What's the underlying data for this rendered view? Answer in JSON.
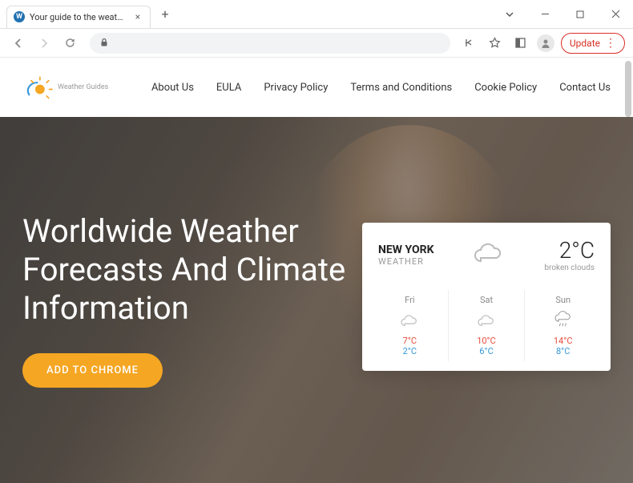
{
  "browser": {
    "tab_title": "Your guide to the weather – wor...",
    "favicon_letter": "W",
    "update_button": "Update"
  },
  "site": {
    "logo_text": "Weather Guides",
    "nav": [
      "About Us",
      "EULA",
      "Privacy Policy",
      "Terms and Conditions",
      "Cookie Policy",
      "Contact Us"
    ]
  },
  "hero": {
    "title": "Worldwide Weather Forecasts And Climate Information",
    "cta": "ADD TO CHROME"
  },
  "weather": {
    "city": "NEW YORK",
    "subtitle": "WEATHER",
    "current_temp": "2°C",
    "current_cond": "broken clouds",
    "days": [
      {
        "name": "Fri",
        "icon": "cloud",
        "hi": "7°C",
        "lo": "2°C"
      },
      {
        "name": "Sat",
        "icon": "cloud",
        "hi": "10°C",
        "lo": "6°C"
      },
      {
        "name": "Sun",
        "icon": "rain",
        "hi": "14°C",
        "lo": "8°C"
      }
    ]
  },
  "colors": {
    "accent": "#f5a623",
    "temp_hi": "#e74c3c",
    "temp_lo": "#3498db",
    "update": "#d93025"
  }
}
